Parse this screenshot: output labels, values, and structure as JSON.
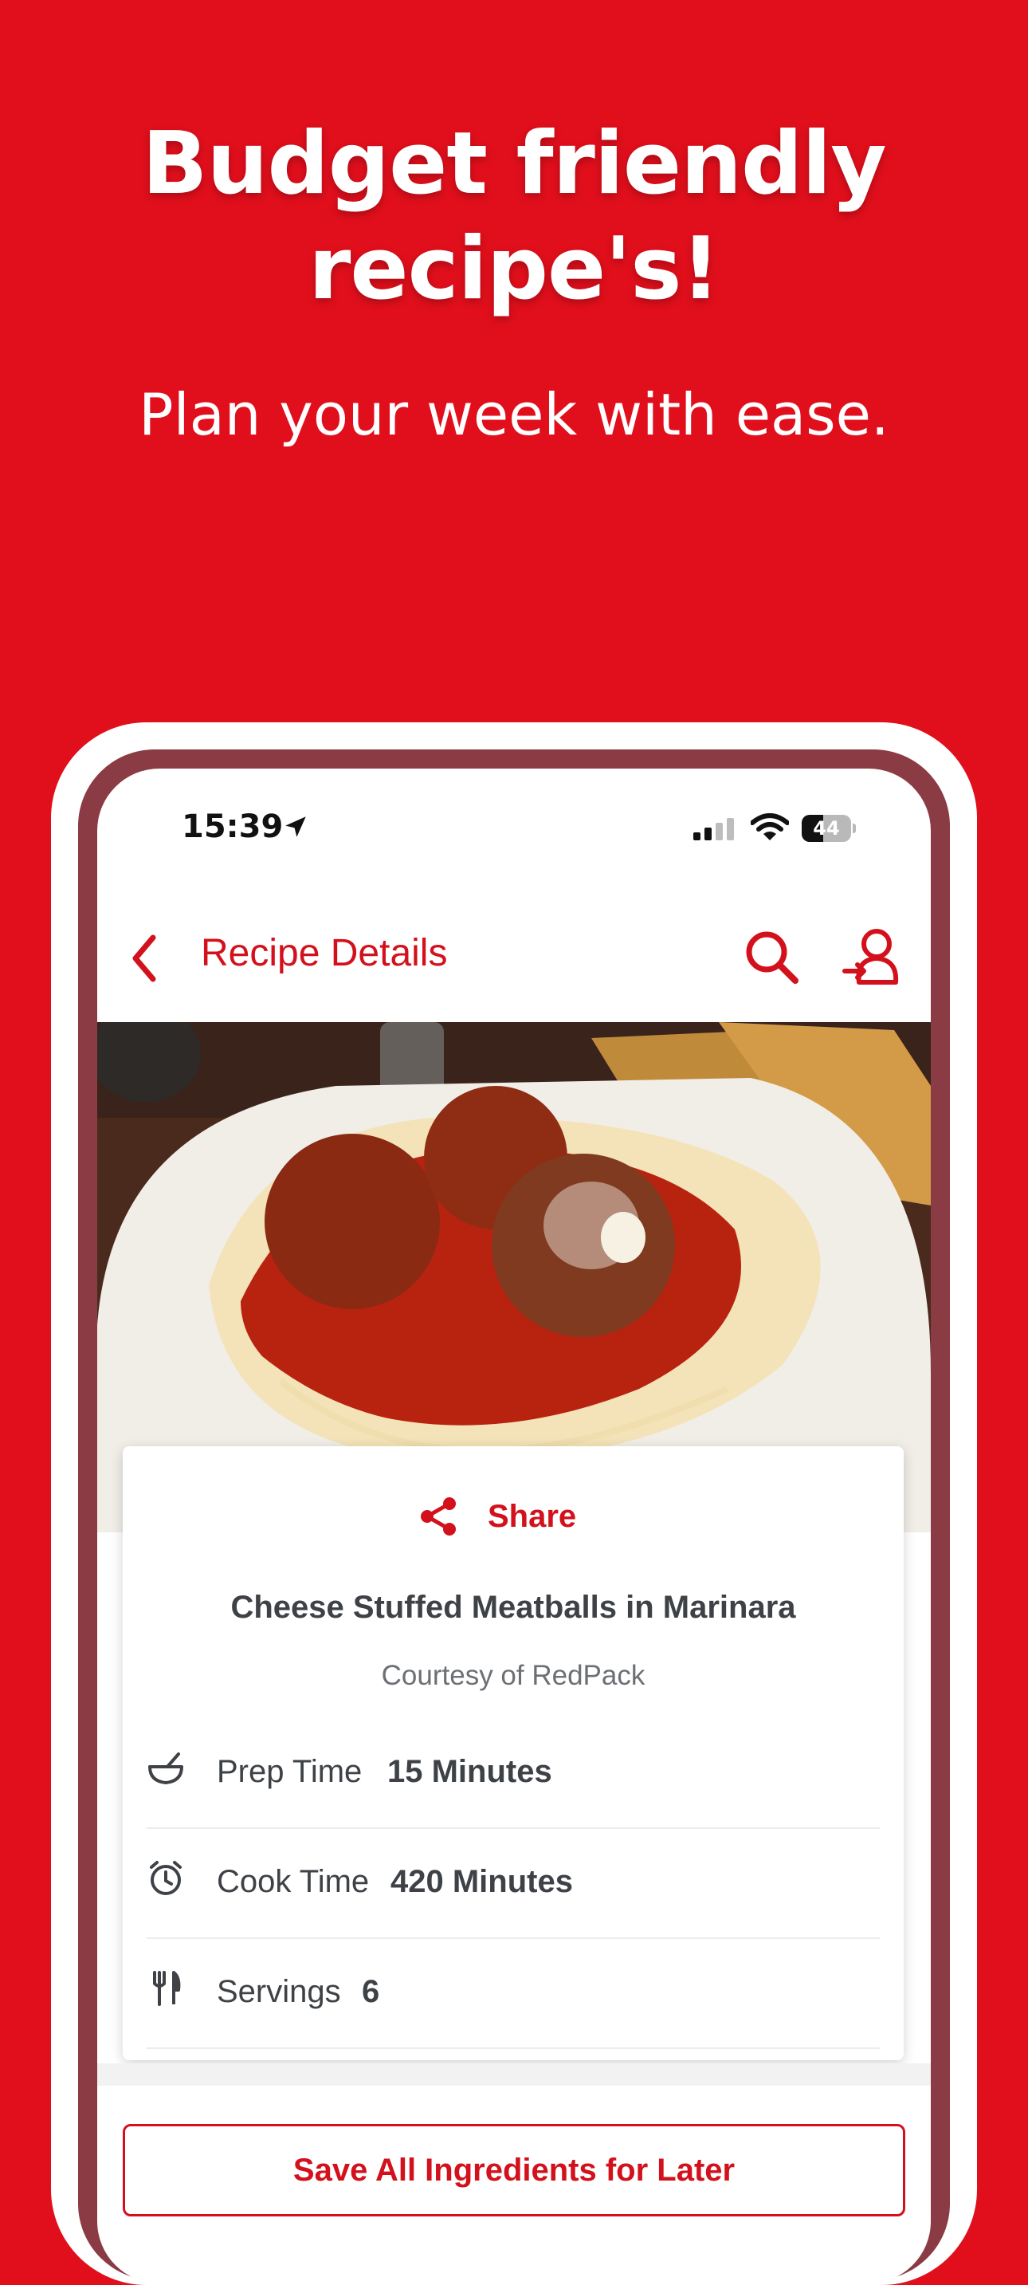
{
  "hero": {
    "title_line1": "Budget friendly",
    "title_line2": "recipe's!",
    "subtitle": "Plan your week with ease."
  },
  "status_bar": {
    "time": "15:39",
    "battery_level": 44,
    "battery_text": "44"
  },
  "nav": {
    "title": "Recipe Details"
  },
  "recipe": {
    "share_label": "Share",
    "title": "Cheese Stuffed Meatballs in Marinara",
    "courtesy": "Courtesy of RedPack",
    "prep": {
      "label": "Prep Time",
      "value": "15 Minutes"
    },
    "cook": {
      "label": "Cook Time",
      "value": "420 Minutes"
    },
    "servings": {
      "label": "Servings",
      "value": "6"
    }
  },
  "actions": {
    "save_label": "Save All Ingredients for Later"
  },
  "colors": {
    "brand_red": "#e10f1c",
    "accent_red": "#d3111c",
    "frame": "#8a3b43",
    "text_dark": "#3e4247",
    "text_muted": "#6c7075"
  },
  "icons": {
    "back": "chevron-left-icon",
    "search": "search-icon",
    "account": "user-login-icon",
    "share": "share-icon",
    "prep": "mixing-bowl-icon",
    "cook": "alarm-clock-icon",
    "servings": "fork-knife-icon"
  }
}
